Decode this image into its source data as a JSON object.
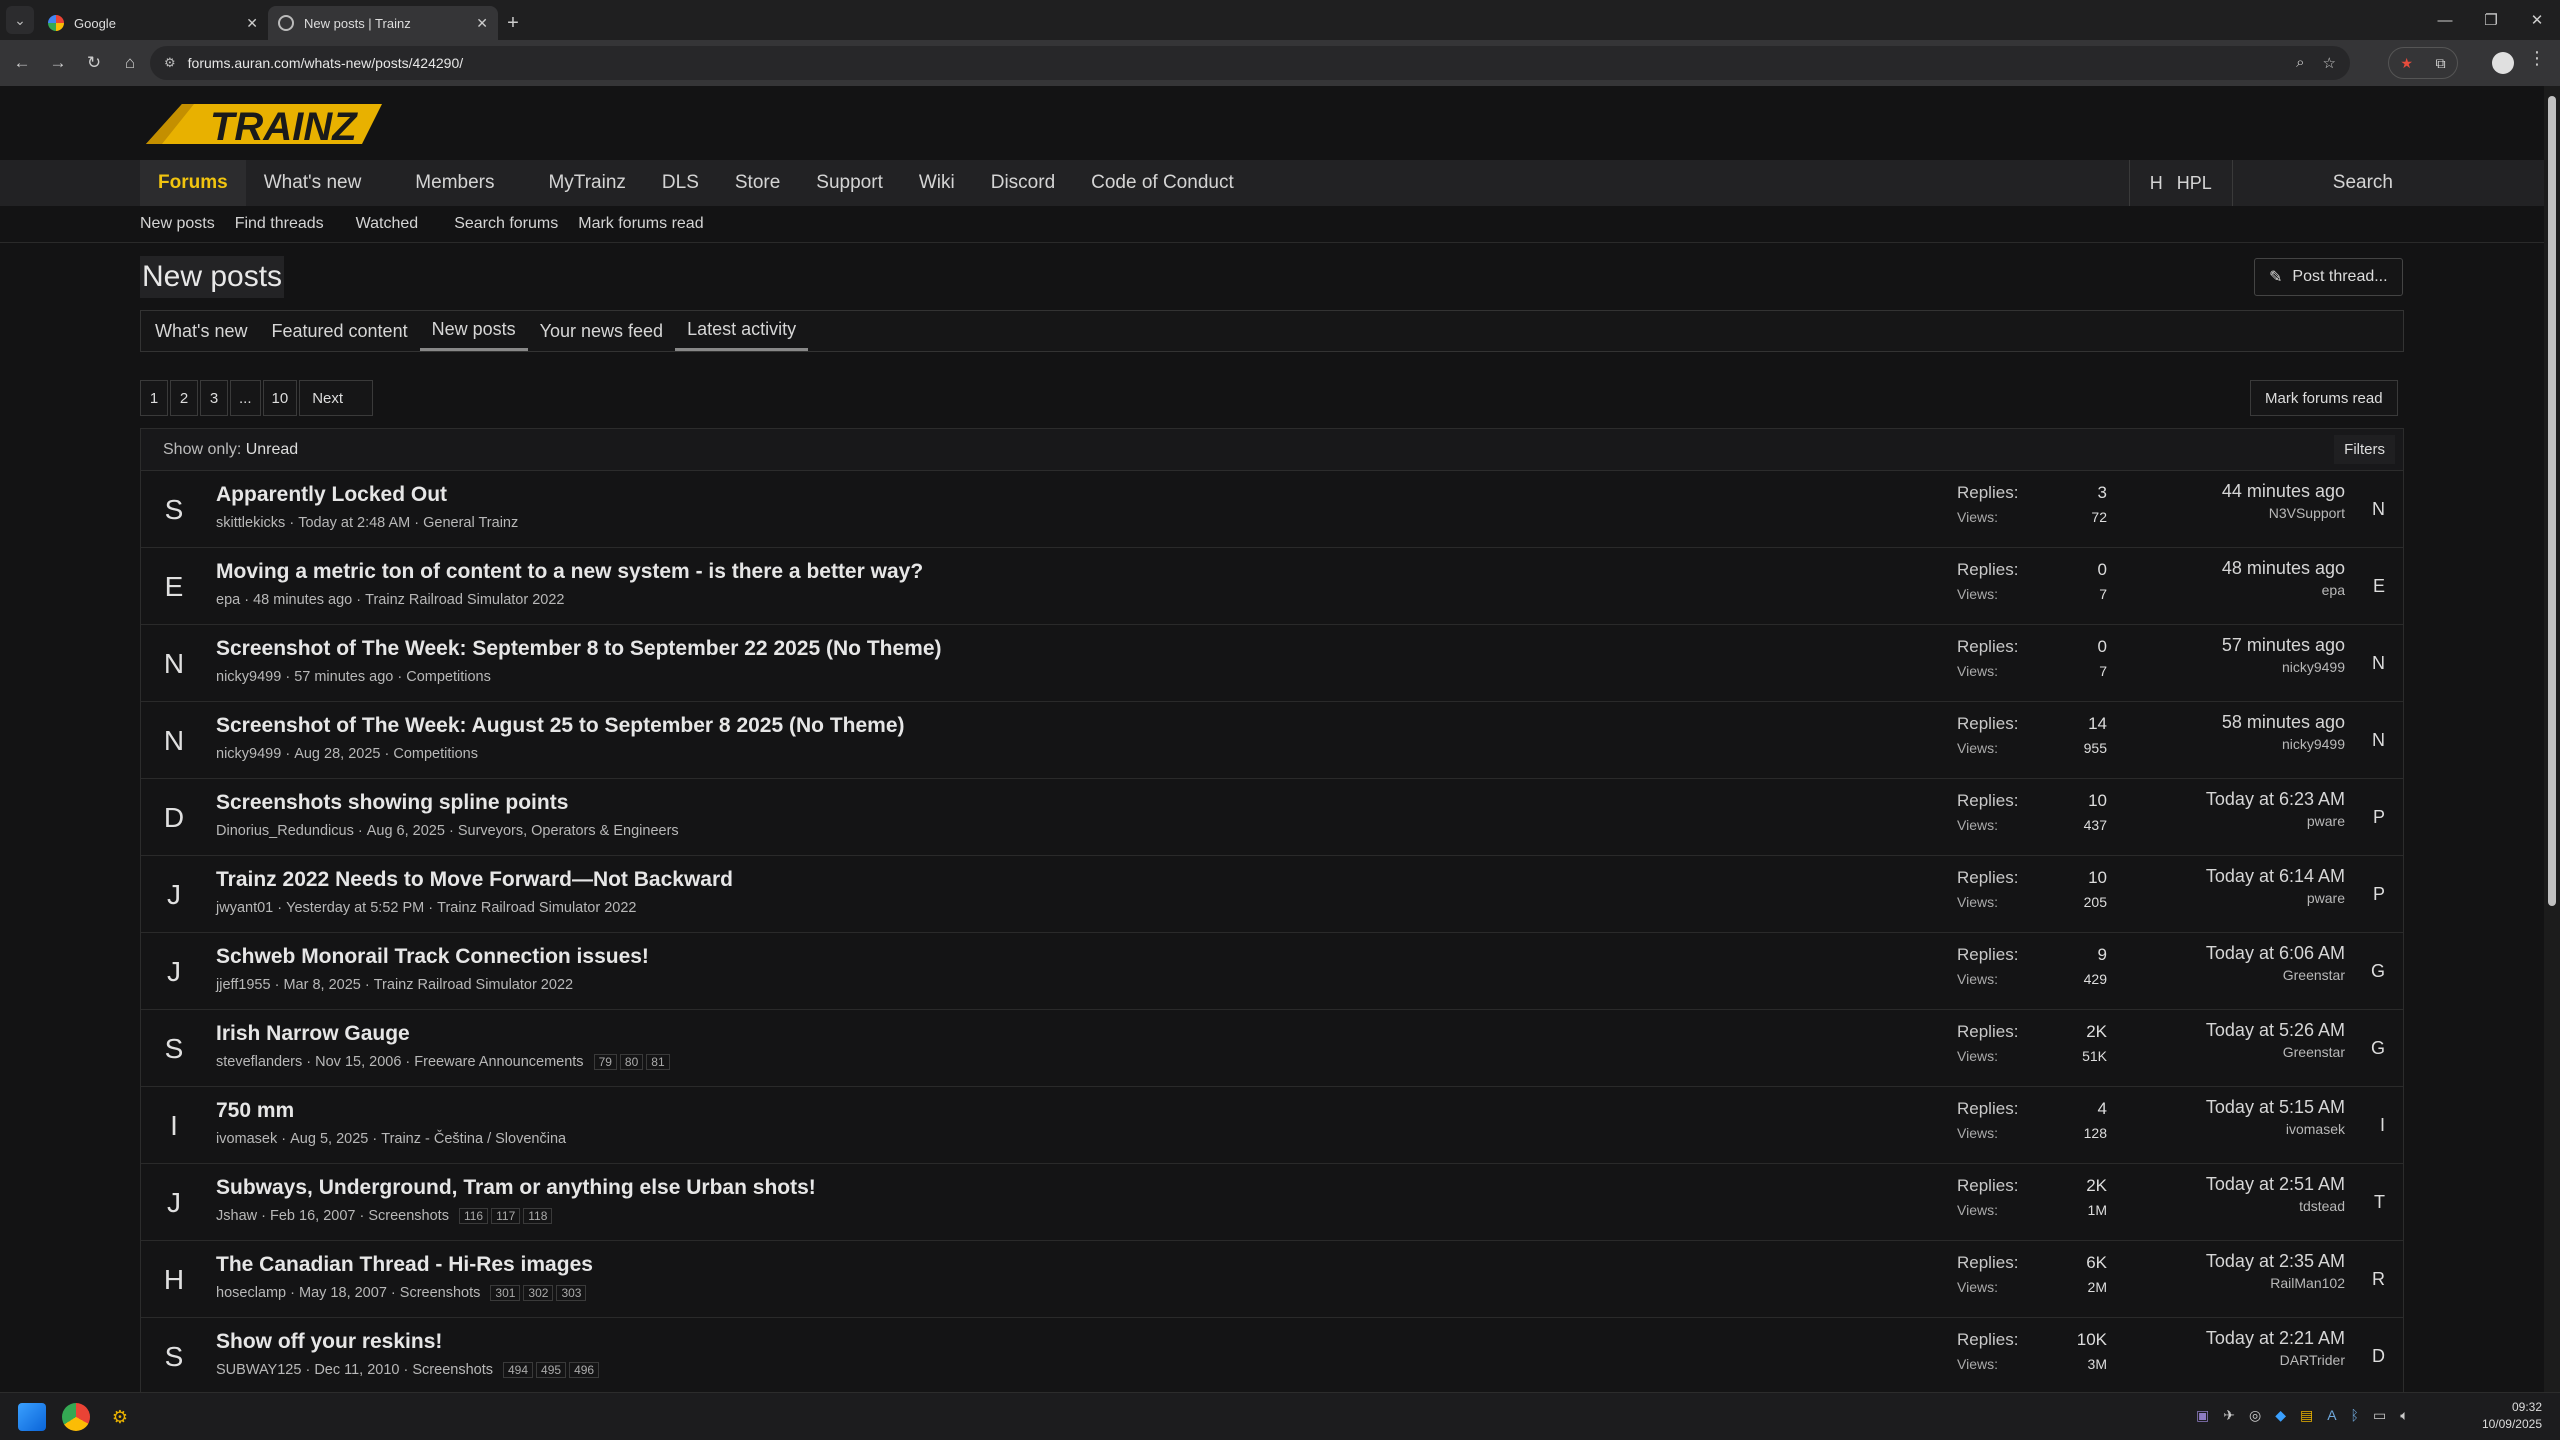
{
  "browser": {
    "tabs": [
      {
        "title": "Google",
        "active": false
      },
      {
        "title": "New posts | Trainz",
        "active": true
      }
    ],
    "url": "forums.auran.com/whats-new/posts/424290/"
  },
  "site": {
    "logo_text": "TRAINZ",
    "nav": [
      "Forums",
      "What's new",
      "Members",
      "MyTrainz",
      "DLS",
      "Store",
      "Support",
      "Wiki",
      "Discord",
      "Code of Conduct"
    ],
    "user_initial": "H",
    "user_name": "HPL",
    "search_label": "Search",
    "subnav": [
      "New posts",
      "Find threads",
      "Watched",
      "Search forums",
      "Mark forums read"
    ]
  },
  "main": {
    "title": "New posts",
    "post_thread_label": "Post thread...",
    "tabs": [
      "What's new",
      "Featured content",
      "New posts",
      "Your news feed",
      "Latest activity"
    ],
    "pager": [
      "1",
      "2",
      "3",
      "...",
      "10"
    ],
    "pager_next": "Next",
    "mark_read_label": "Mark forums read",
    "filter_label": "Show only:",
    "filter_value": "Unread",
    "filters_button": "Filters",
    "replies_label": "Replies:",
    "views_label": "Views:"
  },
  "threads": [
    {
      "initial": "S",
      "title": "Apparently Locked Out",
      "author": "skittlekicks",
      "date": "Today at 2:48 AM",
      "forum": "General Trainz",
      "pages": [],
      "replies": "3",
      "views": "72",
      "last_time": "44 minutes ago",
      "last_user": "N3VSupport",
      "last_initial": "N"
    },
    {
      "initial": "E",
      "title": "Moving a metric ton of content to a new system - is there a better way?",
      "author": "epa",
      "date": "48 minutes ago",
      "forum": "Trainz Railroad Simulator 2022",
      "pages": [],
      "replies": "0",
      "views": "7",
      "last_time": "48 minutes ago",
      "last_user": "epa",
      "last_initial": "E"
    },
    {
      "initial": "N",
      "title": "Screenshot of The Week: September 8 to September 22 2025 (No Theme)",
      "author": "nicky9499",
      "date": "57 minutes ago",
      "forum": "Competitions",
      "pages": [],
      "replies": "0",
      "views": "7",
      "last_time": "57 minutes ago",
      "last_user": "nicky9499",
      "last_initial": "N"
    },
    {
      "initial": "N",
      "title": "Screenshot of The Week: August 25 to September 8 2025 (No Theme)",
      "author": "nicky9499",
      "date": "Aug 28, 2025",
      "forum": "Competitions",
      "pages": [],
      "replies": "14",
      "views": "955",
      "last_time": "58 minutes ago",
      "last_user": "nicky9499",
      "last_initial": "N"
    },
    {
      "initial": "D",
      "title": "Screenshots showing spline points",
      "author": "Dinorius_Redundicus",
      "date": "Aug 6, 2025",
      "forum": "Surveyors, Operators & Engineers",
      "pages": [],
      "replies": "10",
      "views": "437",
      "last_time": "Today at 6:23 AM",
      "last_user": "pware",
      "last_initial": "P"
    },
    {
      "initial": "J",
      "title": "Trainz 2022 Needs to Move Forward—Not Backward",
      "author": "jwyant01",
      "date": "Yesterday at 5:52 PM",
      "forum": "Trainz Railroad Simulator 2022",
      "pages": [],
      "replies": "10",
      "views": "205",
      "last_time": "Today at 6:14 AM",
      "last_user": "pware",
      "last_initial": "P"
    },
    {
      "initial": "J",
      "title": "Schweb Monorail Track Connection issues!",
      "author": "jjeff1955",
      "date": "Mar 8, 2025",
      "forum": "Trainz Railroad Simulator 2022",
      "pages": [],
      "replies": "9",
      "views": "429",
      "last_time": "Today at 6:06 AM",
      "last_user": "Greenstar",
      "last_initial": "G"
    },
    {
      "initial": "S",
      "title": "Irish Narrow Gauge",
      "author": "steveflanders",
      "date": "Nov 15, 2006",
      "forum": "Freeware Announcements",
      "pages": [
        "79",
        "80",
        "81"
      ],
      "replies": "2K",
      "views": "51K",
      "last_time": "Today at 5:26 AM",
      "last_user": "Greenstar",
      "last_initial": "G"
    },
    {
      "initial": "I",
      "title": "750 mm",
      "author": "ivomasek",
      "date": "Aug 5, 2025",
      "forum": "Trainz - Čeština / Slovenčina",
      "pages": [],
      "replies": "4",
      "views": "128",
      "last_time": "Today at 5:15 AM",
      "last_user": "ivomasek",
      "last_initial": "I"
    },
    {
      "initial": "J",
      "title": "Subways, Underground, Tram or anything else Urban shots!",
      "author": "Jshaw",
      "date": "Feb 16, 2007",
      "forum": "Screenshots",
      "pages": [
        "116",
        "117",
        "118"
      ],
      "replies": "2K",
      "views": "1M",
      "last_time": "Today at 2:51 AM",
      "last_user": "tdstead",
      "last_initial": "T"
    },
    {
      "initial": "H",
      "title": "The Canadian Thread - Hi-Res images",
      "author": "hoseclamp",
      "date": "May 18, 2007",
      "forum": "Screenshots",
      "pages": [
        "301",
        "302",
        "303"
      ],
      "replies": "6K",
      "views": "2M",
      "last_time": "Today at 2:35 AM",
      "last_user": "RailMan102",
      "last_initial": "R"
    },
    {
      "initial": "S",
      "title": "Show off your reskins!",
      "author": "SUBWAY125",
      "date": "Dec 11, 2010",
      "forum": "Screenshots",
      "pages": [
        "494",
        "495",
        "496"
      ],
      "replies": "10K",
      "views": "3M",
      "last_time": "Today at 2:21 AM",
      "last_user": "DARTrider",
      "last_initial": "D"
    }
  ],
  "taskbar": {
    "time": "09:32",
    "date": "10/09/2025"
  },
  "colors": {
    "accent": "#f1c40f",
    "logo_yellow": "#e8b100",
    "background": "#131314"
  }
}
